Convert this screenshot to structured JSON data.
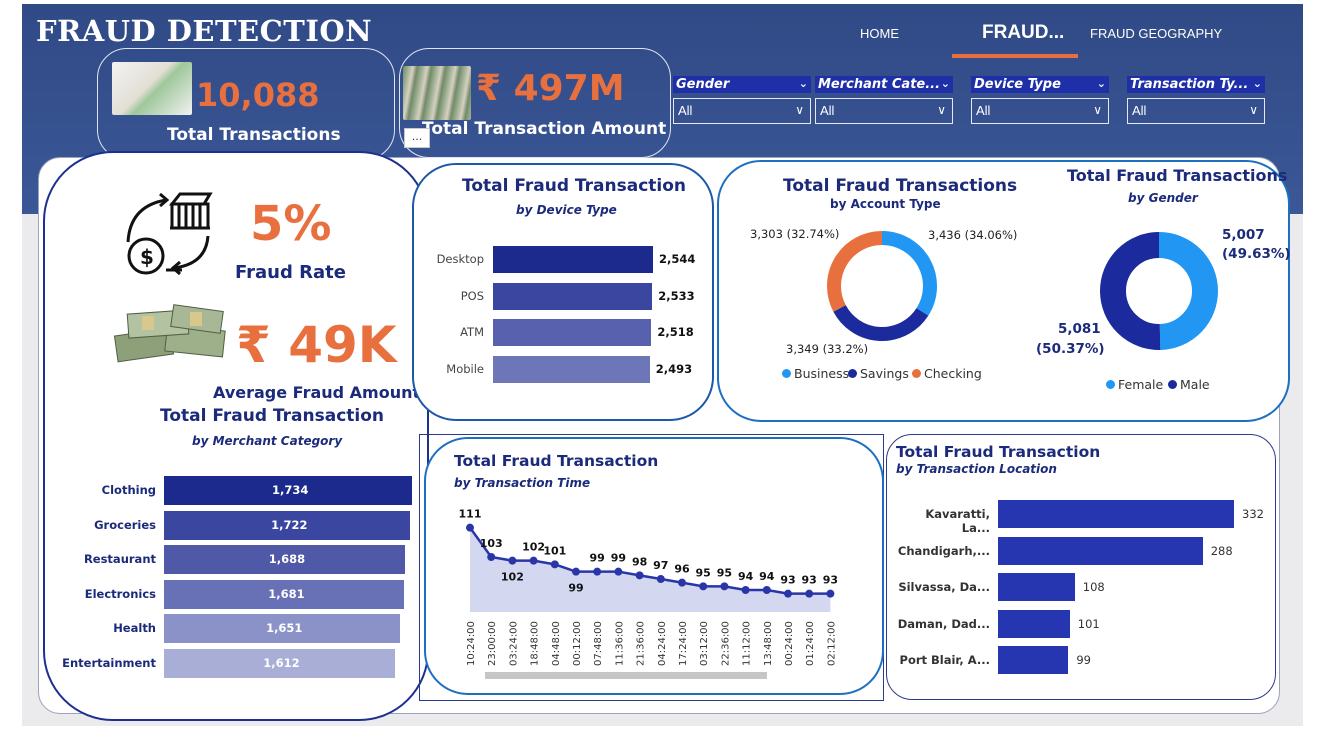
{
  "header": {
    "title": "FRAUD DETECTION",
    "nav": [
      "HOME",
      "FRAUD...",
      "FRAUD GEOGRAPHY"
    ],
    "more_menu": "..."
  },
  "kpis": {
    "total_transactions": {
      "value": "10,088",
      "label": "Total Transactions"
    },
    "total_amount": {
      "value": "₹ 497M",
      "label": "Total Transaction Amount"
    },
    "fraud_rate": {
      "value": "5%",
      "label": "Fraud Rate"
    },
    "avg_fraud_amount": {
      "value": "₹ 49K",
      "label": "Average Fraud Amount"
    }
  },
  "slicers": [
    {
      "title": "Gender",
      "value": "All"
    },
    {
      "title": "Merchant Cate...",
      "value": "All"
    },
    {
      "title": "Device Type",
      "value": "All"
    },
    {
      "title": "Transaction Ty...",
      "value": "All"
    }
  ],
  "colors": {
    "banner": "#304a86",
    "accent_orange": "#e8703f",
    "title_navy": "#1b2a7a",
    "bar_dark": "#1b2a8c",
    "donut_light_blue": "#2196f3",
    "donut_dark_blue": "#1b2a9c"
  },
  "icons": [
    "money-cycle-icon",
    "handshake-cash-image",
    "cash-stack-image",
    "money-pile-image"
  ],
  "charts": {
    "device": {
      "title": "Total Fraud Transaction",
      "subtitle": "by Device Type",
      "categories": [
        "Desktop",
        "POS",
        "ATM",
        "Mobile"
      ],
      "values": [
        2544,
        2533,
        2518,
        2493
      ],
      "labels": [
        "2,544",
        "2,533",
        "2,518",
        "2,493"
      ]
    },
    "merchant": {
      "title": "Total Fraud Transaction",
      "subtitle": "by Merchant Category",
      "categories": [
        "Clothing",
        "Groceries",
        "Restaurant",
        "Electronics",
        "Health",
        "Entertainment"
      ],
      "values": [
        1734,
        1722,
        1688,
        1681,
        1651,
        1612
      ],
      "labels": [
        "1,734",
        "1,722",
        "1,688",
        "1,681",
        "1,651",
        "1,612"
      ]
    },
    "account": {
      "title": "Total Fraud Transactions",
      "subtitle": "by Account Type",
      "labels": [
        "Business",
        "Savings",
        "Checking"
      ],
      "values": [
        3436,
        3349,
        3303
      ],
      "data_labels": [
        "3,436 (34.06%)",
        "3,349 (33.2%)",
        "3,303 (32.74%)"
      ]
    },
    "gender": {
      "title": "Total Fraud Transactions",
      "subtitle": "by Gender",
      "labels": [
        "Female",
        "Male"
      ],
      "values": [
        5007,
        5081
      ],
      "data_labels": [
        "5,007",
        "(49.63%)",
        "5,081",
        "(50.37%)"
      ]
    },
    "time": {
      "title": "Total Fraud Transaction",
      "subtitle": "by Transaction Time",
      "x": [
        "10:24:00",
        "23:00:00",
        "03:24:00",
        "18:48:00",
        "04:48:00",
        "00:12:00",
        "07:48:00",
        "11:36:00",
        "21:36:00",
        "04:24:00",
        "17:24:00",
        "03:12:00",
        "22:36:00",
        "11:12:00",
        "13:48:00",
        "00:24:00",
        "01:24:00",
        "02:12:00"
      ],
      "y": [
        111,
        103,
        102,
        102,
        101,
        99,
        99,
        99,
        98,
        97,
        96,
        95,
        95,
        94,
        94,
        93,
        93,
        93
      ]
    },
    "location": {
      "title": "Total Fraud Transaction",
      "subtitle": "by Transaction Location",
      "categories": [
        "Kavaratti, La...",
        "Chandigarh,...",
        "Silvassa, Da...",
        "Daman, Dad...",
        "Port Blair, A..."
      ],
      "values": [
        332,
        288,
        108,
        101,
        99
      ]
    }
  },
  "chart_data": [
    {
      "type": "bar",
      "title": "Total Fraud Transaction",
      "subtitle": "by Device Type",
      "categories": [
        "Desktop",
        "POS",
        "ATM",
        "Mobile"
      ],
      "values": [
        2544,
        2533,
        2518,
        2493
      ]
    },
    {
      "type": "bar",
      "title": "Total Fraud Transaction",
      "subtitle": "by Merchant Category",
      "categories": [
        "Clothing",
        "Groceries",
        "Restaurant",
        "Electronics",
        "Health",
        "Entertainment"
      ],
      "values": [
        1734,
        1722,
        1688,
        1681,
        1651,
        1612
      ]
    },
    {
      "type": "pie",
      "title": "Total Fraud Transactions",
      "subtitle": "by Account Type",
      "labels": [
        "Business",
        "Savings",
        "Checking"
      ],
      "values": [
        3436,
        3349,
        3303
      ]
    },
    {
      "type": "pie",
      "title": "Total Fraud Transactions",
      "subtitle": "by Gender",
      "labels": [
        "Female",
        "Male"
      ],
      "values": [
        5007,
        5081
      ]
    },
    {
      "type": "area",
      "title": "Total Fraud Transaction",
      "subtitle": "by Transaction Time",
      "x": [
        "10:24:00",
        "23:00:00",
        "03:24:00",
        "18:48:00",
        "04:48:00",
        "00:12:00",
        "07:48:00",
        "11:36:00",
        "21:36:00",
        "04:24:00",
        "17:24:00",
        "03:12:00",
        "22:36:00",
        "11:12:00",
        "13:48:00",
        "00:24:00",
        "01:24:00",
        "02:12:00"
      ],
      "y": [
        111,
        103,
        102,
        102,
        101,
        99,
        99,
        99,
        98,
        97,
        96,
        95,
        95,
        94,
        94,
        93,
        93,
        93
      ]
    },
    {
      "type": "bar",
      "title": "Total Fraud Transaction",
      "subtitle": "by Transaction Location",
      "categories": [
        "Kavaratti, La...",
        "Chandigarh,...",
        "Silvassa, Da...",
        "Daman, Dad...",
        "Port Blair, A..."
      ],
      "values": [
        332,
        288,
        108,
        101,
        99
      ]
    }
  ]
}
